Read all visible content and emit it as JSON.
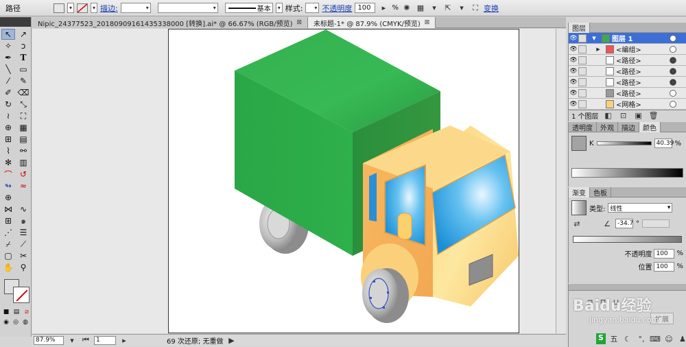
{
  "control_bar": {
    "object_type": "路径",
    "stroke_link": "描边:",
    "stroke_profile": "基本",
    "style_label": "样式:",
    "opacity_link": "不透明度",
    "opacity_value": "100",
    "opacity_unit": "%",
    "transform_link": "变换"
  },
  "tabs": [
    {
      "label": "Nipic_24377523_20180909161435338000 [转换].ai* @ 66.67% (RGB/预览)",
      "close": "⊠"
    },
    {
      "label": "未标题-1* @ 87.9% (CMYK/预览)",
      "close": "⊠"
    }
  ],
  "status": {
    "zoom": "87.9%",
    "page": "1",
    "history": "69 次还原; 无重做",
    "arrow": "▶"
  },
  "layers_panel": {
    "tab": "图层",
    "rows": [
      {
        "name": "图层 1",
        "level": 0,
        "selected": true
      },
      {
        "name": "<编组>",
        "level": 1
      },
      {
        "name": "<路径>",
        "level": 1,
        "filled": true
      },
      {
        "name": "<路径>",
        "level": 1,
        "filled": true
      },
      {
        "name": "<路径>",
        "level": 1,
        "filled": true
      },
      {
        "name": "<路径>",
        "level": 1
      },
      {
        "name": "<网格>",
        "level": 1
      }
    ],
    "footer": "1 个图层"
  },
  "color_panel": {
    "tabs": [
      "透明度",
      "外观",
      "描边",
      "颜色"
    ],
    "k_label": "K",
    "k_value": "40.39",
    "k_unit": "%"
  },
  "gradient_panel": {
    "tabs": [
      "渐变",
      "色板"
    ],
    "type_label": "类型:",
    "type_value": "线性",
    "angle_value": "-34.7",
    "angle_unit": "°",
    "opacity_label": "不透明度",
    "opacity_value": "100",
    "position_label": "位置",
    "position_value": "100",
    "unit": "%"
  },
  "bottom_panel": {
    "expand": "扩展",
    "watermark_text": "Baidu经验",
    "watermark_url": "jingyan.baidu.com"
  },
  "colors": {
    "truck_green": "#2eae4c",
    "truck_yellow": "#fbcf72",
    "truck_window": "#2aa6e8",
    "selection_blue": "#3c6fd6"
  }
}
